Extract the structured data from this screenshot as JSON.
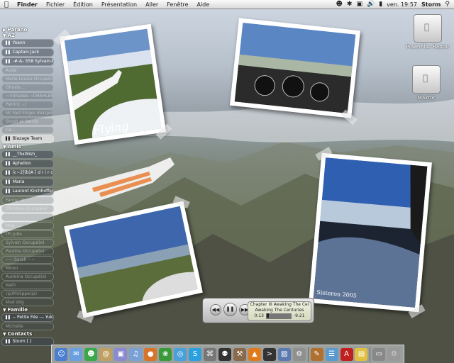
{
  "menubar": {
    "apple": "",
    "items": [
      "Finder",
      "Fichier",
      "Édition",
      "Présentation",
      "Aller",
      "Fenêtre",
      "Aide"
    ],
    "clock": "ven. 19:57",
    "user": "Storm"
  },
  "buddy": {
    "groups": [
      {
        "name": "Parano",
        "buddies": []
      },
      {
        "name": "A2",
        "buddies": [
          {
            "name": "Yoann",
            "state": "online"
          },
          {
            "name": "Captain Jack",
            "state": "online"
          },
          {
            "name": "-#-&- 558 Sylvain-B",
            "state": "online"
          },
          {
            "name": "Aude",
            "state": "idle"
          },
          {
            "name": "Marie Louisa Occupé(e)",
            "state": "idle"
          },
          {
            "name": "Ghosts ...",
            "state": "idle"
          },
          {
            "name": "~!!Shades ~CHAHLEN",
            "state": "idle"
          },
          {
            "name": "Patrick ;-)",
            "state": "idle"
          },
          {
            "name": "Mr Fast Finger disciple",
            "state": "idle"
          },
          {
            "name": "Steph et Sandy",
            "state": "idle"
          },
          {
            "name": "Ce...",
            "state": "idle"
          },
          {
            "name": "Blazage Team",
            "state": "selected"
          }
        ]
      },
      {
        "name": "Amis",
        "buddies": [
          {
            "name": "__ThxWish_",
            "state": "online"
          },
          {
            "name": "Aphelion",
            "state": "online"
          },
          {
            "name": "(c~2](b)A [ d r i r c [r]t]",
            "state": "online"
          },
          {
            "name": "Maria",
            "state": "online"
          },
          {
            "name": "Laurent Kirchhoffer",
            "state": "online"
          },
          {
            "name": "Fanny !!!",
            "state": "idle"
          },
          {
            "name": "Christine Occupé(e)",
            "state": "idle"
          },
          {
            "name": "...",
            "state": "idle"
          },
          {
            "name": "Meg ...",
            "state": "idle"
          },
          {
            "name": "(P) Julie",
            "state": "idle"
          },
          {
            "name": "Sylvain Occupé(e)",
            "state": "idle"
          },
          {
            "name": "Pauline Occupé(e)",
            "state": "idle"
          },
          {
            "name": "~~ Sorah ~~",
            "state": "idle"
          },
          {
            "name": "Ninon",
            "state": "idle"
          },
          {
            "name": "Aurelina Occupé(e)",
            "state": "idle"
          },
          {
            "name": "Nath",
            "state": "idle"
          },
          {
            "name": "(ip)Philippe(ip)",
            "state": "idle"
          },
          {
            "name": "Mad dog",
            "state": "idle"
          }
        ]
      },
      {
        "name": "Famille",
        "buddies": [
          {
            "name": "-- Petite Fée --- Yuki",
            "state": "online"
          },
          {
            "name": "Michelle",
            "state": "idle"
          }
        ]
      },
      {
        "name": "Contacts",
        "buddies": [
          {
            "name": "Storm [ ]",
            "state": "online"
          }
        ]
      }
    ]
  },
  "photos": {
    "flying_caption": "Flying",
    "sisteron_caption": "Sisteron 2005"
  },
  "disks": [
    {
      "label": "PowerMac Raptor"
    },
    {
      "label": "Maxtor"
    }
  ],
  "itunes": {
    "line1": "Chapter III  Awaking The Cei",
    "line2": "Awaking The Centuries",
    "elapsed": "0:13",
    "remaining": "-9:21",
    "progress": 0.03
  },
  "dock": {
    "icons": [
      "finder-icon",
      "mail-icon",
      "ichat-icon",
      "addressbook-icon",
      "preview-icon",
      "itunes-icon",
      "firefox-icon",
      "adium-icon",
      "safari-icon",
      "skype-icon",
      "network-icon",
      "tux-icon",
      "tool-icon",
      "vlc-icon",
      "terminal-icon",
      "photo-icon",
      "automator-icon",
      "sep",
      "script-icon",
      "graph-icon",
      "acrobat-icon",
      "stickies-icon",
      "sep",
      "disk-icon",
      "trash-icon"
    ]
  }
}
